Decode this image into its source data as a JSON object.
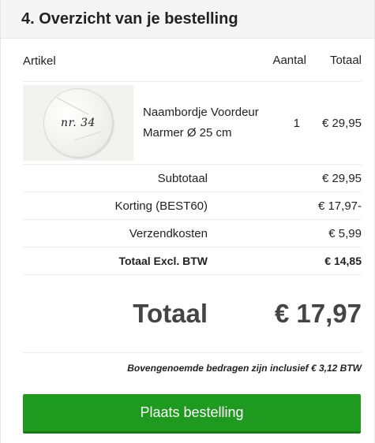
{
  "section": {
    "title": "4. Overzicht van je bestelling"
  },
  "table": {
    "headers": {
      "article": "Artikel",
      "quantity": "Aantal",
      "total": "Totaal"
    },
    "product": {
      "image_text": "nr. 34",
      "name_line1": "Naambordje Voordeur",
      "name_line2": "Marmer Ø 25 cm",
      "quantity": "1",
      "total": "€ 29,95"
    }
  },
  "summary": {
    "subtotal_label": "Subtotaal",
    "subtotal_value": "€ 29,95",
    "discount_label": "Korting (BEST60)",
    "discount_value": "€ 17,97-",
    "shipping_label": "Verzendkosten",
    "shipping_value": "€ 5,99",
    "excl_label": "Totaal Excl. BTW",
    "excl_value": "€ 14,85"
  },
  "grand_total": {
    "label": "Totaal",
    "value": "€ 17,97"
  },
  "vat_note": "Bovengenoemde bedragen zijn inclusief € 3,12 BTW",
  "actions": {
    "place_order": "Plaats bestelling"
  },
  "colors": {
    "button": "#1e9a1e",
    "header_bg": "#f5f5f5"
  }
}
